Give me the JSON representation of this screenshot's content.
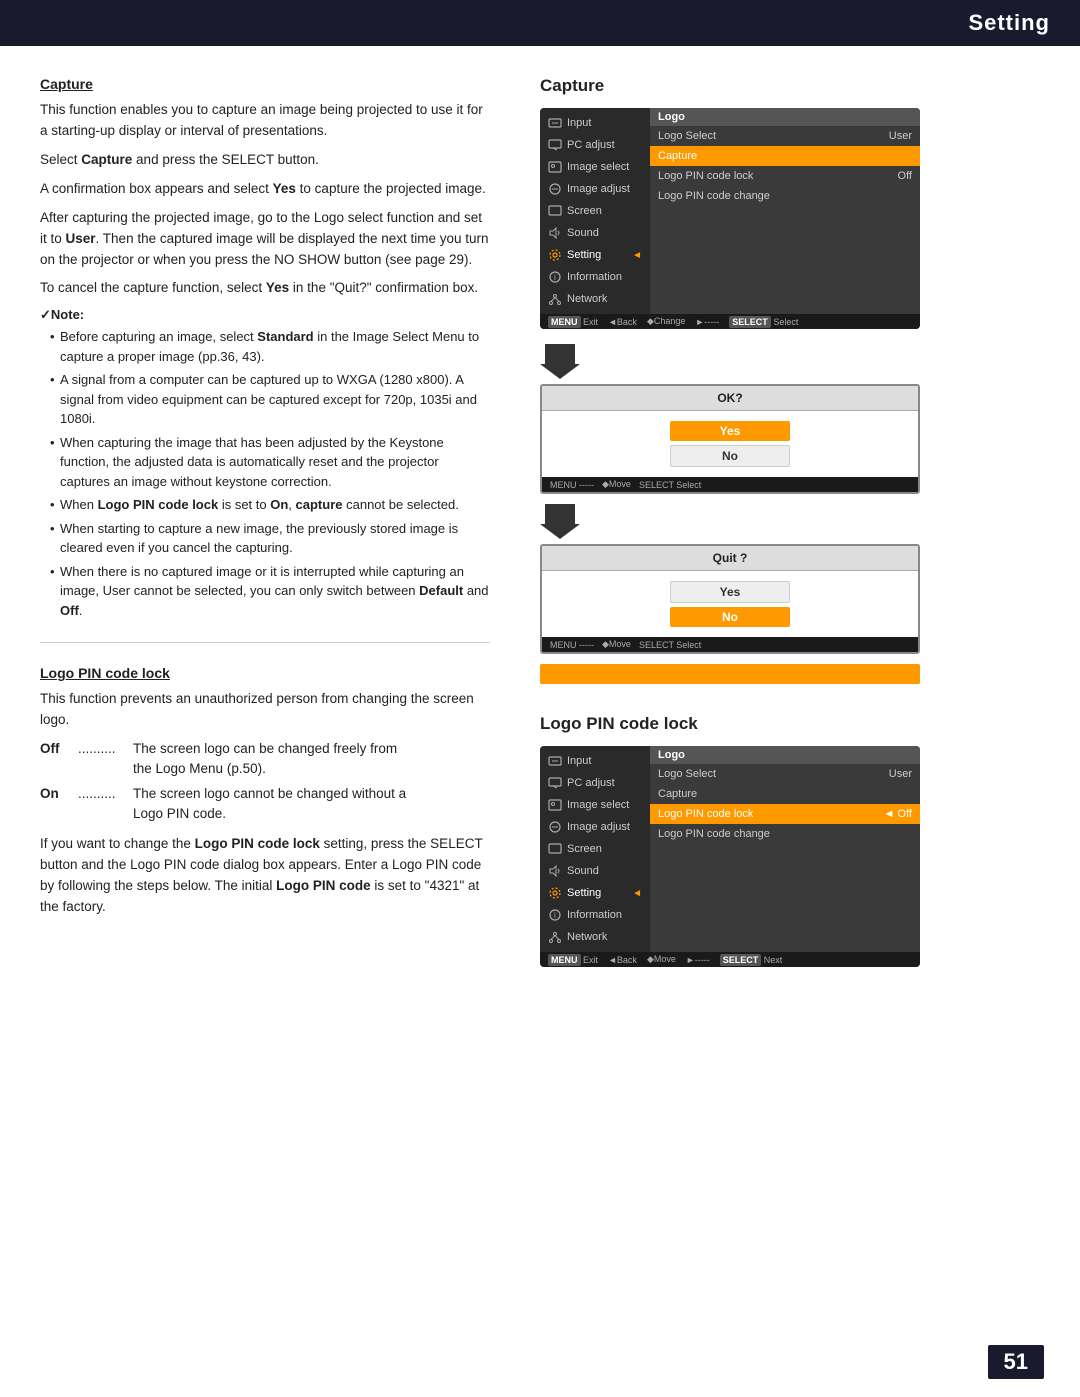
{
  "header": {
    "title": "Setting"
  },
  "page_number": "51",
  "left": {
    "capture_section": {
      "heading": "Capture",
      "para1": "This function enables you to capture an image being projected to use it for a starting-up display or interval of presentations.",
      "para2_prefix": "Select ",
      "para2_bold": "Capture",
      "para2_suffix": " and press the SELECT button.",
      "para3_prefix": "A confirmation box appears and select ",
      "para3_bold": "Yes",
      "para3_suffix": " to capture the projected image.",
      "para4_prefix": "After capturing the projected image, go to the Logo select function and set it to ",
      "para4_bold": "User",
      "para4_suffix": ". Then the captured image will be displayed the next time you turn on the projector or when you press the NO SHOW button (see page 29).",
      "para5_prefix": "To cancel the capture function, select ",
      "para5_bold": "Yes",
      "para5_suffix": " in the \"Quit?\" confirmation box.",
      "note_label": "Note:",
      "notes": [
        "Before capturing an image, select Standard in the Image Select Menu to capture a proper image (pp.36, 43).",
        "A signal from a computer can be captured up to WXGA (1280 x800). A signal from video equipment can be captured except for 720p, 1035i and 1080i.",
        "When capturing the image that has been adjusted by the Keystone function, the adjusted data is automatically reset and the projector captures an image without keystone correction.",
        "When Logo PIN code lock is set to On, capture cannot be selected.",
        "When starting to capture a new image, the previously stored image is cleared even if you cancel the capturing.",
        "When there is no captured image or it is interrupted while capturing an image, User cannot be selected, you can only switch between Default and Off."
      ],
      "notes_bold": [
        "Logo PIN code lock",
        "On",
        "capture",
        "Default",
        "Off"
      ]
    },
    "logo_pin_section": {
      "heading": "Logo PIN code lock",
      "para1": "This function prevents an unauthorized person from changing the screen logo.",
      "off_label": "Off",
      "off_dots": "..........",
      "off_desc": "The screen logo can be changed freely from the Logo Menu (p.50).",
      "on_label": "On",
      "on_dots": "..........",
      "on_desc": "The screen logo cannot be changed without a Logo PIN code.",
      "para2_prefix": "If you want to change the ",
      "para2_bold": "Logo PIN code lock",
      "para2_suffix": " setting, press the SELECT button and the Logo PIN code dialog box appears. Enter a Logo PIN code by following the steps below. The initial ",
      "para2_bold2": "Logo PIN code",
      "para2_suffix2": " is set to \"4321\" at the factory."
    }
  },
  "right": {
    "capture_title": "Capture",
    "logo_pin_title": "Logo PIN code lock",
    "capture_panel": {
      "menu_items": [
        {
          "icon": "input-icon",
          "label": "Input",
          "active": false
        },
        {
          "icon": "pc-icon",
          "label": "PC adjust",
          "active": false
        },
        {
          "icon": "image-select-icon",
          "label": "Image select",
          "active": false
        },
        {
          "icon": "image-adjust-icon",
          "label": "Image adjust",
          "active": false
        },
        {
          "icon": "screen-icon",
          "label": "Screen",
          "active": false
        },
        {
          "icon": "sound-icon",
          "label": "Sound",
          "active": false
        },
        {
          "icon": "setting-icon",
          "label": "Setting",
          "active": true
        },
        {
          "icon": "info-icon",
          "label": "Information",
          "active": false
        },
        {
          "icon": "network-icon",
          "label": "Network",
          "active": false
        }
      ],
      "submenu_header": "Logo",
      "submenu_items": [
        {
          "label": "Logo Select",
          "value": "User",
          "state": "normal"
        },
        {
          "label": "Capture",
          "value": "",
          "state": "highlighted"
        },
        {
          "label": "Logo PIN code lock",
          "value": "Off",
          "state": "normal"
        },
        {
          "label": "Logo PIN code change",
          "value": "",
          "state": "normal"
        }
      ],
      "bottom_bar": [
        "MENU Exit",
        "◄Back",
        "◆Change",
        "►-----",
        "SELECT Select"
      ]
    },
    "dialog_ok": {
      "title": "OK?",
      "buttons": [
        "Yes",
        "No"
      ],
      "yes_active": true,
      "bottom_bar": [
        "MENU -----",
        "◆Move",
        "SELECT Select"
      ]
    },
    "dialog_quit": {
      "title": "Quit ?",
      "buttons": [
        "Yes",
        "No"
      ],
      "no_active": true,
      "bottom_bar": [
        "MENU -----",
        "◆Move",
        "SELECT Select"
      ]
    },
    "logo_pin_panel": {
      "menu_items": [
        {
          "icon": "input-icon",
          "label": "Input",
          "active": false
        },
        {
          "icon": "pc-icon",
          "label": "PC adjust",
          "active": false
        },
        {
          "icon": "image-select-icon",
          "label": "Image select",
          "active": false
        },
        {
          "icon": "image-adjust-icon",
          "label": "Image adjust",
          "active": false
        },
        {
          "icon": "screen-icon",
          "label": "Screen",
          "active": false
        },
        {
          "icon": "sound-icon",
          "label": "Sound",
          "active": false
        },
        {
          "icon": "setting-icon",
          "label": "Setting",
          "active": true
        },
        {
          "icon": "info-icon",
          "label": "Information",
          "active": false
        },
        {
          "icon": "network-icon",
          "label": "Network",
          "active": false
        }
      ],
      "submenu_header": "Logo",
      "submenu_items": [
        {
          "label": "Logo Select",
          "value": "User",
          "state": "normal"
        },
        {
          "label": "Capture",
          "value": "",
          "state": "normal"
        },
        {
          "label": "Logo PIN code lock",
          "value": "Off",
          "state": "highlighted"
        },
        {
          "label": "Logo PIN code change",
          "value": "",
          "state": "normal"
        }
      ],
      "bottom_bar": [
        "MENU Exit",
        "◄Back",
        "◆Move",
        "►-----",
        "SELECT Next"
      ]
    }
  }
}
